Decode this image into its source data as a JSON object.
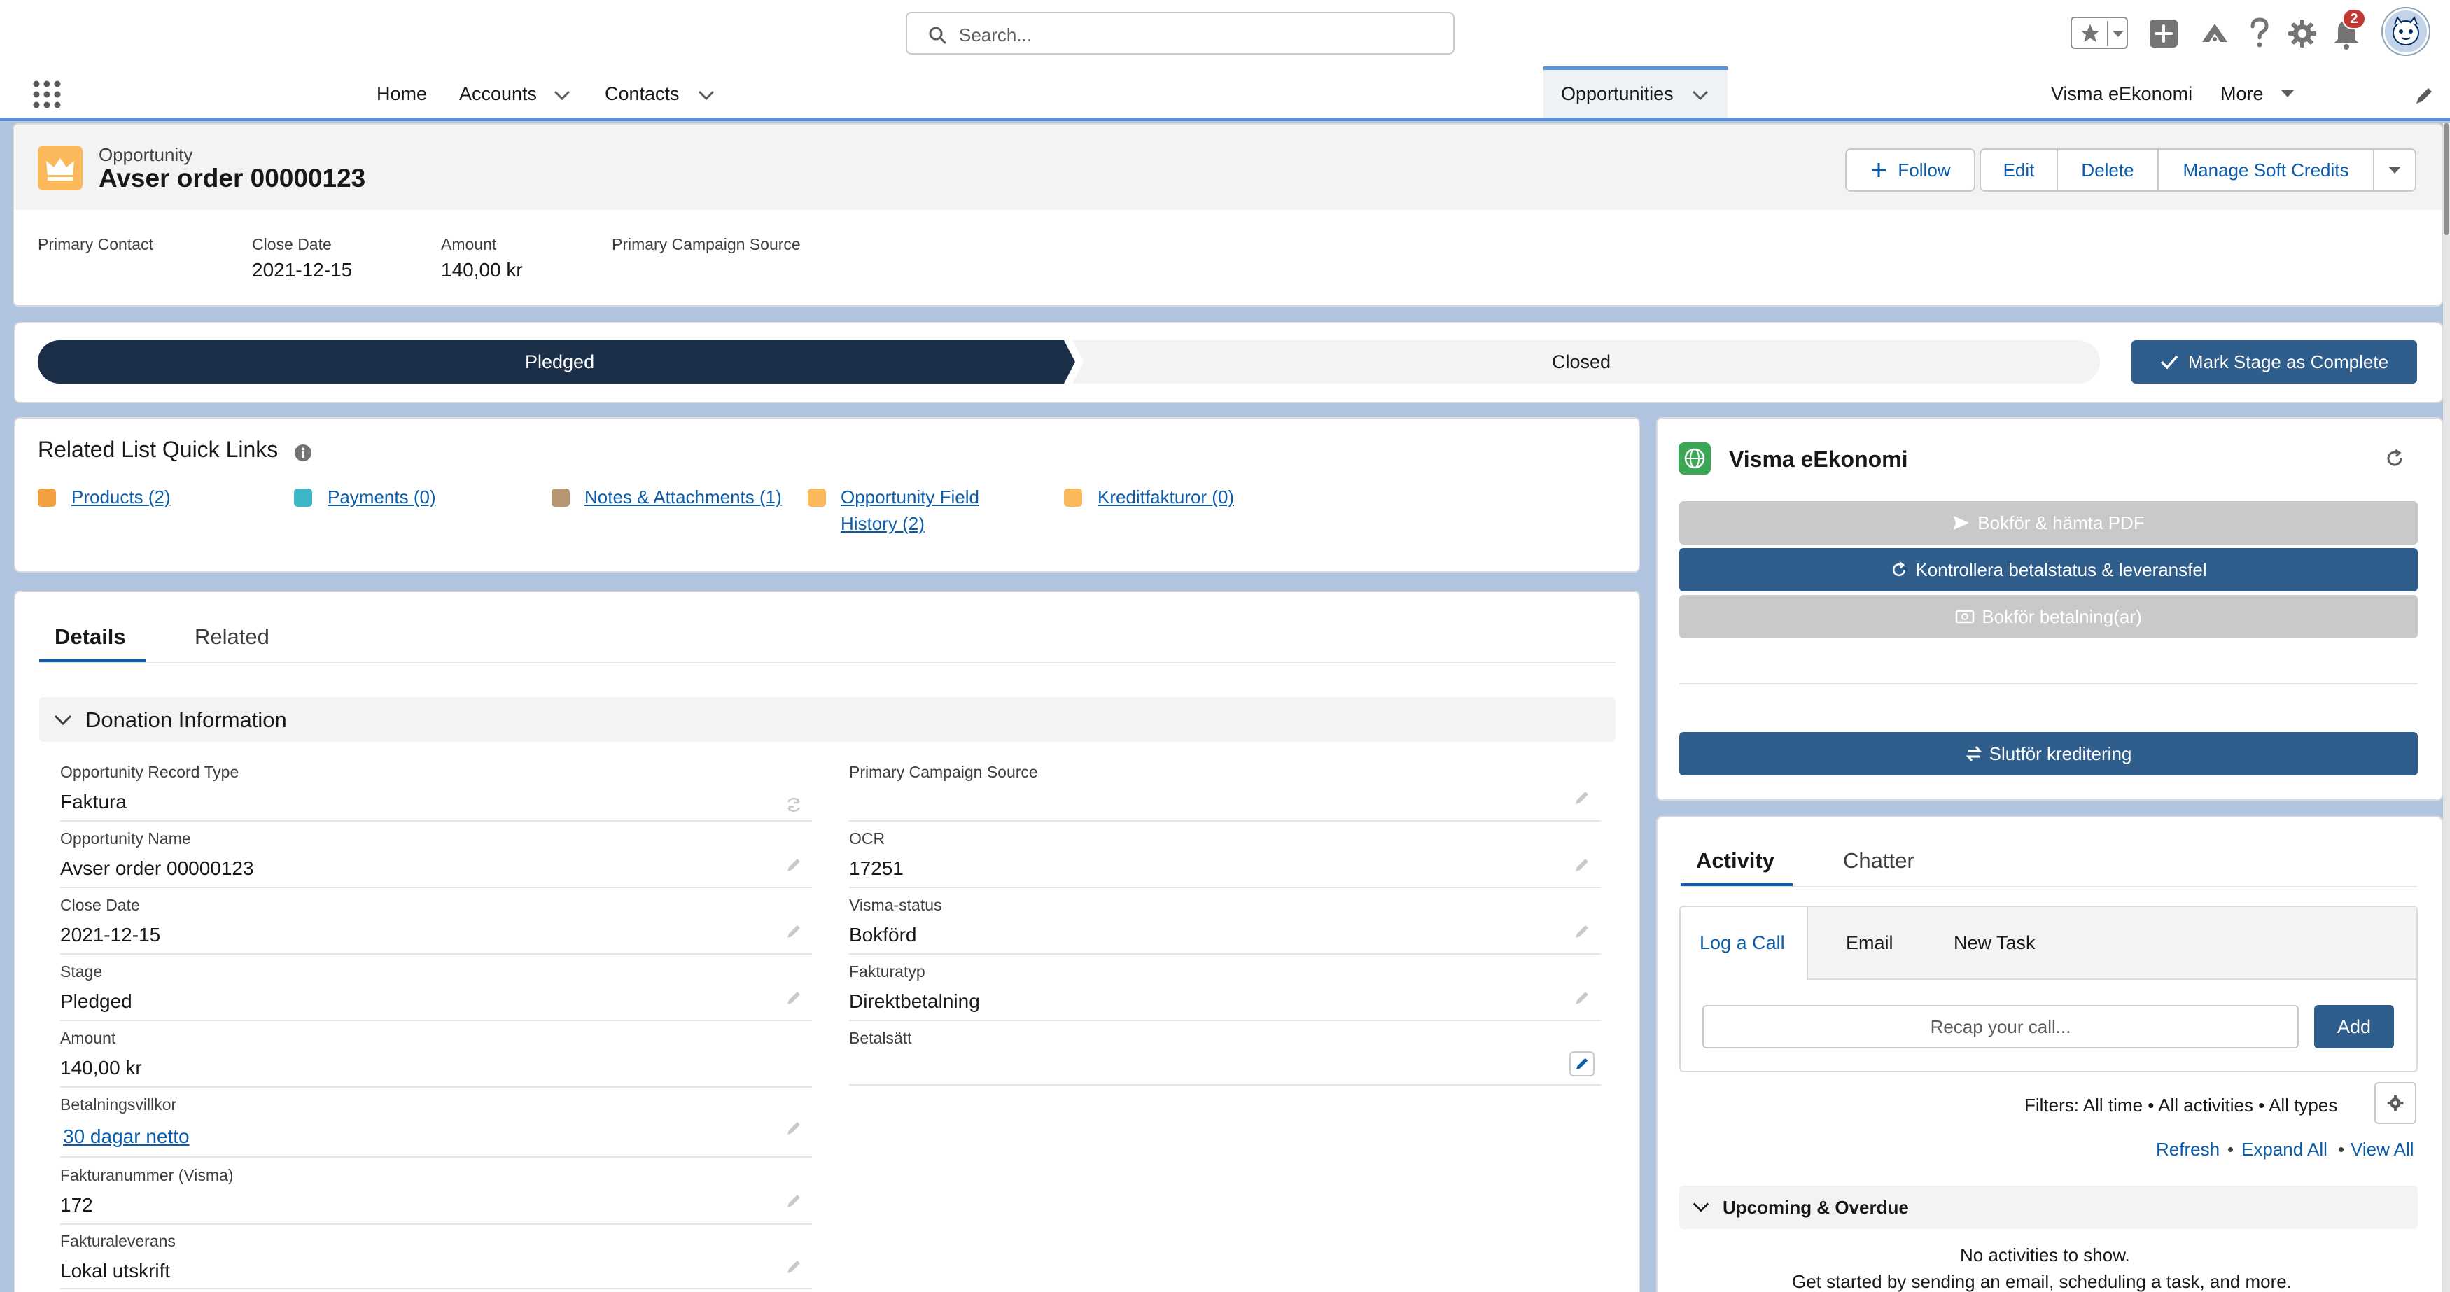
{
  "header": {
    "search_placeholder": "Search...",
    "notification_count": "2"
  },
  "nav": {
    "items": [
      "Home",
      "Accounts",
      "Contacts",
      "Opportunities",
      "Visma eEkonomi",
      "More"
    ]
  },
  "record": {
    "object_label": "Opportunity",
    "title": "Avser order 00000123",
    "buttons": {
      "follow": "Follow",
      "edit": "Edit",
      "delete": "Delete",
      "manage": "Manage Soft Credits"
    },
    "highlights": [
      {
        "label": "Primary Contact",
        "value": ""
      },
      {
        "label": "Close Date",
        "value": "2021-12-15"
      },
      {
        "label": "Amount",
        "value": "140,00 kr"
      },
      {
        "label": "Primary Campaign Source",
        "value": ""
      }
    ]
  },
  "path": {
    "stages": [
      "Pledged",
      "Closed"
    ],
    "current_stage": "Pledged",
    "mark_complete": "Mark Stage as Complete"
  },
  "quick_links": {
    "title": "Related List Quick Links",
    "items": [
      "Products (2)",
      "Payments (0)",
      "Notes & Attachments (1)",
      "Opportunity Field",
      "History (2)",
      "Kreditfakturor (0)"
    ]
  },
  "details": {
    "tabs": [
      "Details",
      "Related"
    ],
    "section_title": "Donation Information",
    "left_fields": [
      {
        "label": "Opportunity Record Type",
        "value": "Faktura"
      },
      {
        "label": "Opportunity Name",
        "value": "Avser order 00000123"
      },
      {
        "label": "Close Date",
        "value": "2021-12-15"
      },
      {
        "label": "Stage",
        "value": "Pledged"
      },
      {
        "label": "Amount",
        "value": "140,00 kr"
      },
      {
        "label": "Betalningsvillkor",
        "value": "30 dagar netto"
      },
      {
        "label": "Fakturanummer (Visma)",
        "value": "172"
      },
      {
        "label": "Fakturaleverans",
        "value": "Lokal utskrift"
      }
    ],
    "right_fields": [
      {
        "label": "Primary Campaign Source",
        "value": ""
      },
      {
        "label": "OCR",
        "value": "17251"
      },
      {
        "label": "Visma-status",
        "value": "Bokförd"
      },
      {
        "label": "Fakturatyp",
        "value": "Direktbetalning"
      },
      {
        "label": "Betalsätt",
        "value": ""
      }
    ]
  },
  "visma": {
    "title": "Visma eEkonomi",
    "buttons": [
      "Bokför & hämta PDF",
      "Kontrollera betalstatus & leveransfel",
      "Bokför betalning(ar)",
      "Slutför kreditering"
    ]
  },
  "activity": {
    "tabs": [
      "Activity",
      "Chatter"
    ],
    "sub_tabs": [
      "Log a Call",
      "Email",
      "New Task"
    ],
    "recap_placeholder": "Recap your call...",
    "add_label": "Add",
    "filters": "Filters: All time • All activities • All types",
    "links": [
      "Refresh",
      "Expand All",
      "View All"
    ],
    "upcoming_title": "Upcoming & Overdue",
    "empty_title": "No activities to show.",
    "empty_sub": "Get started by sending an email, scheduling a task, and more."
  },
  "colors": {
    "brand": "#0b5cab",
    "path_active": "#1b2f48",
    "button_blue": "#2f5d8c",
    "button_disabled": "#c9c9c9",
    "opportunity_icon": "#fcb95b"
  }
}
